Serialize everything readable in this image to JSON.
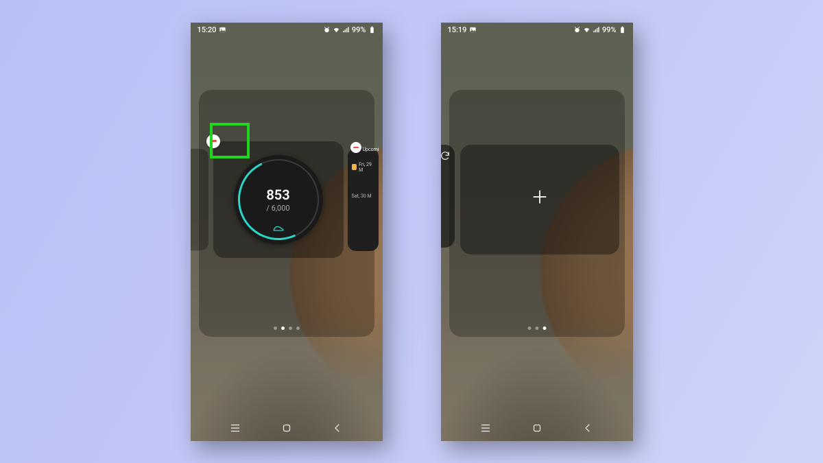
{
  "left": {
    "status": {
      "time": "15:20",
      "battery": "99%"
    },
    "widget": {
      "steps": "853",
      "goal": "/ 6,000"
    },
    "peek": {
      "header": "Upcomi",
      "day1": "Fri, 29 M",
      "day2": "Sat, 30 M"
    },
    "page_indicator": {
      "total": 4,
      "active": 1
    }
  },
  "right": {
    "status": {
      "time": "15:19",
      "battery": "99%"
    },
    "page_indicator": {
      "total": 3,
      "active": 2
    }
  }
}
